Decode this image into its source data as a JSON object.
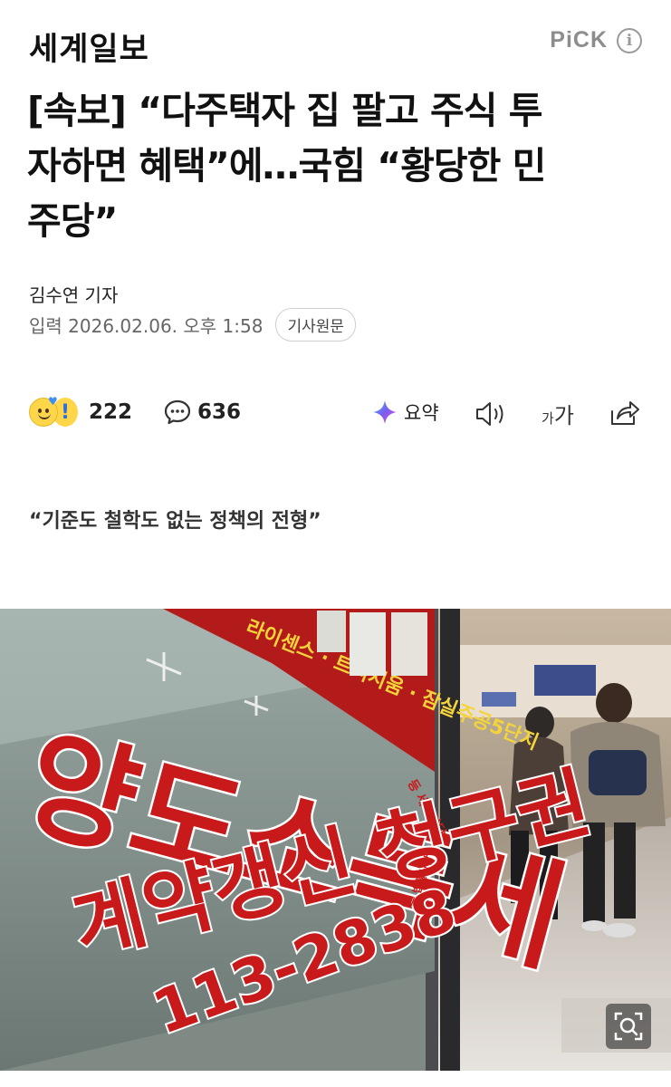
{
  "header": {
    "press_name": "세계일보",
    "pick_label": "PiCK",
    "info_icon": "info-circle-icon"
  },
  "article": {
    "headline_lines": [
      "[속보] “다주택자 집 팔고 주식 투",
      "자하면 혜택”에…국힘 “황당한 민",
      "주당”"
    ],
    "reporter": "김수연 기자",
    "date_label": "입력 2026.02.06. 오후 1:58",
    "original_button": "기사원문",
    "subtitle": "“기준도 철학도 없는 정책의 전형”"
  },
  "actions": {
    "reaction_count": "222",
    "comment_count": "636",
    "summary_label": "요약",
    "font_small": "가",
    "font_big": "가"
  },
  "photo": {
    "sign_big": "양도소득세",
    "sign_small": "등 세무상담",
    "sign_top": "라이센스 · 트리지움 · 잠실주공5단지",
    "sign_mid": "계약갱신 청구권",
    "sign_mid_small": "등 법률상담",
    "sign_phone": "113-2838"
  },
  "colors": {
    "accent_purple": "#7b5cf0",
    "sign_red": "#c81a1a",
    "text_gray": "#666666"
  }
}
